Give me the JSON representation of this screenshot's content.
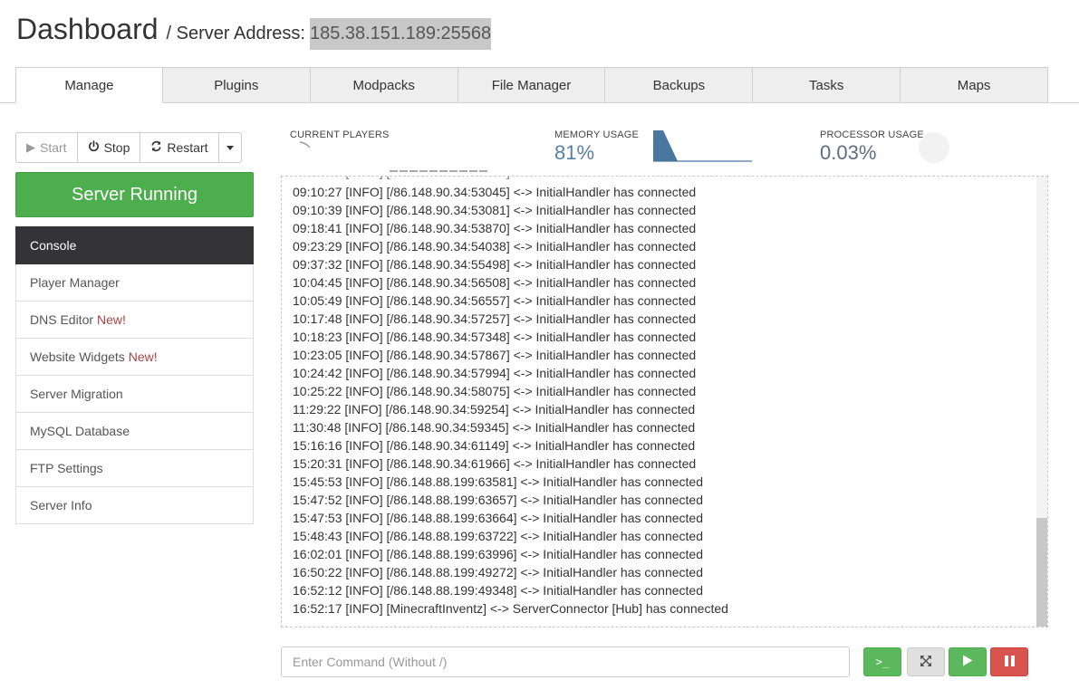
{
  "header": {
    "title": "Dashboard",
    "subtitle": "/ Server Address:",
    "address": "185.38.151.189:25568"
  },
  "tabs": [
    {
      "label": "Manage",
      "active": true
    },
    {
      "label": "Plugins"
    },
    {
      "label": "Modpacks"
    },
    {
      "label": "File Manager"
    },
    {
      "label": "Backups"
    },
    {
      "label": "Tasks"
    },
    {
      "label": "Maps"
    }
  ],
  "controls": {
    "start": "Start",
    "stop": "Stop",
    "restart": "Restart",
    "status": "Server Running"
  },
  "menu": [
    {
      "label": "Console",
      "active": true
    },
    {
      "label": "Player Manager"
    },
    {
      "label": "DNS Editor",
      "badge": "New!"
    },
    {
      "label": "Website Widgets",
      "badge": "New!"
    },
    {
      "label": "Server Migration"
    },
    {
      "label": "MySQL Database"
    },
    {
      "label": "FTP Settings"
    },
    {
      "label": "Server Info"
    }
  ],
  "stats": {
    "players_label": "Current Players",
    "memory_label": "Memory Usage",
    "memory_value": "81%",
    "processor_label": "Processor Usage",
    "processor_value": "0.03%"
  },
  "console": {
    "lines": [
      "09:10:27 [INFO] [/86.148.90.34:53045] <-> InitialHandler has connected",
      "09:10:39 [INFO] [/86.148.90.34:53081] <-> InitialHandler has connected",
      "09:18:41 [INFO] [/86.148.90.34:53870] <-> InitialHandler has connected",
      "09:23:29 [INFO] [/86.148.90.34:54038] <-> InitialHandler has connected",
      "09:37:32 [INFO] [/86.148.90.34:55498] <-> InitialHandler has connected",
      "10:04:45 [INFO] [/86.148.90.34:56508] <-> InitialHandler has connected",
      "10:05:49 [INFO] [/86.148.90.34:56557] <-> InitialHandler has connected",
      "10:17:48 [INFO] [/86.148.90.34:57257] <-> InitialHandler has connected",
      "10:18:23 [INFO] [/86.148.90.34:57348] <-> InitialHandler has connected",
      "10:23:05 [INFO] [/86.148.90.34:57867] <-> InitialHandler has connected",
      "10:24:42 [INFO] [/86.148.90.34:57994] <-> InitialHandler has connected",
      "10:25:22 [INFO] [/86.148.90.34:58075] <-> InitialHandler has connected",
      "11:29:22 [INFO] [/86.148.90.34:59254] <-> InitialHandler has connected",
      "11:30:48 [INFO] [/86.148.90.34:59345] <-> InitialHandler has connected",
      "15:16:16 [INFO] [/86.148.90.34:61149] <-> InitialHandler has connected",
      "15:20:31 [INFO] [/86.148.90.34:61966] <-> InitialHandler has connected",
      "15:45:53 [INFO] [/86.148.88.199:63581] <-> InitialHandler has connected",
      "15:47:52 [INFO] [/86.148.88.199:63657] <-> InitialHandler has connected",
      "15:47:53 [INFO] [/86.148.88.199:63664] <-> InitialHandler has connected",
      "15:48:43 [INFO] [/86.148.88.199:63722] <-> InitialHandler has connected",
      "16:02:01 [INFO] [/86.148.88.199:63996] <-> InitialHandler has connected",
      "16:50:22 [INFO] [/86.148.88.199:49272] <-> InitialHandler has connected",
      "16:52:12 [INFO] [/86.148.88.199:49348] <-> InitialHandler has connected",
      "16:52:17 [INFO] [MinecraftInventz] <-> ServerConnector [Hub] has connected"
    ]
  },
  "command": {
    "placeholder": "Enter Command (Without /)"
  },
  "icons": {
    "terminal": "terminal-icon",
    "fullscreen": "expand-icon",
    "play": "play-icon",
    "pause": "pause-icon"
  },
  "colors": {
    "running": "#4cae4c",
    "danger": "#d9534f",
    "menu_active": "#333338",
    "stat_value": "#5a7fa3",
    "new_badge": "#a94442"
  }
}
